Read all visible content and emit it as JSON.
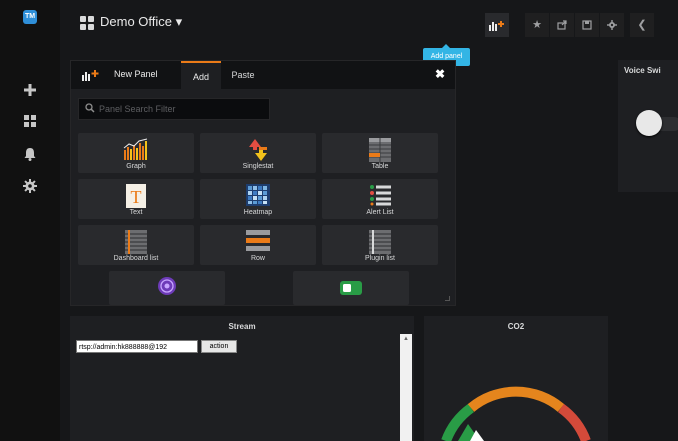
{
  "sidebar": {
    "logo_text": "TM",
    "items": [
      "plus-icon",
      "dashboards-icon",
      "bell-icon",
      "gear-icon"
    ]
  },
  "header": {
    "dashboard_title": "Demo Office ▾",
    "tooltip": "Add panel",
    "buttons": [
      "add-panel-icon",
      "star-icon",
      "share-icon",
      "save-icon",
      "settings-icon",
      "chevron-left-icon"
    ]
  },
  "add_panel": {
    "title": "New Panel",
    "tabs": [
      "Add",
      "Paste"
    ],
    "close": "✖",
    "search_placeholder": "Panel Search Filter",
    "cards": [
      {
        "label": "Graph"
      },
      {
        "label": "Singlestat"
      },
      {
        "label": "Table"
      },
      {
        "label": "Text"
      },
      {
        "label": "Heatmap"
      },
      {
        "label": "Alert List"
      },
      {
        "label": "Dashboard list"
      },
      {
        "label": "Row"
      },
      {
        "label": "Plugin list"
      }
    ]
  },
  "panels": {
    "stream": {
      "title": "Stream",
      "input_value": "rtsp://admin:hk888888@192",
      "button": "action"
    },
    "co2": {
      "title": "CO2"
    },
    "voice": {
      "title": "Voice Swi"
    }
  },
  "colors": {
    "accent_orange": "#eb7b18",
    "tooltip_blue": "#33b5e5",
    "gauge_green": "#299c46",
    "gauge_orange": "#e5851d",
    "gauge_red": "#d44a3a"
  }
}
